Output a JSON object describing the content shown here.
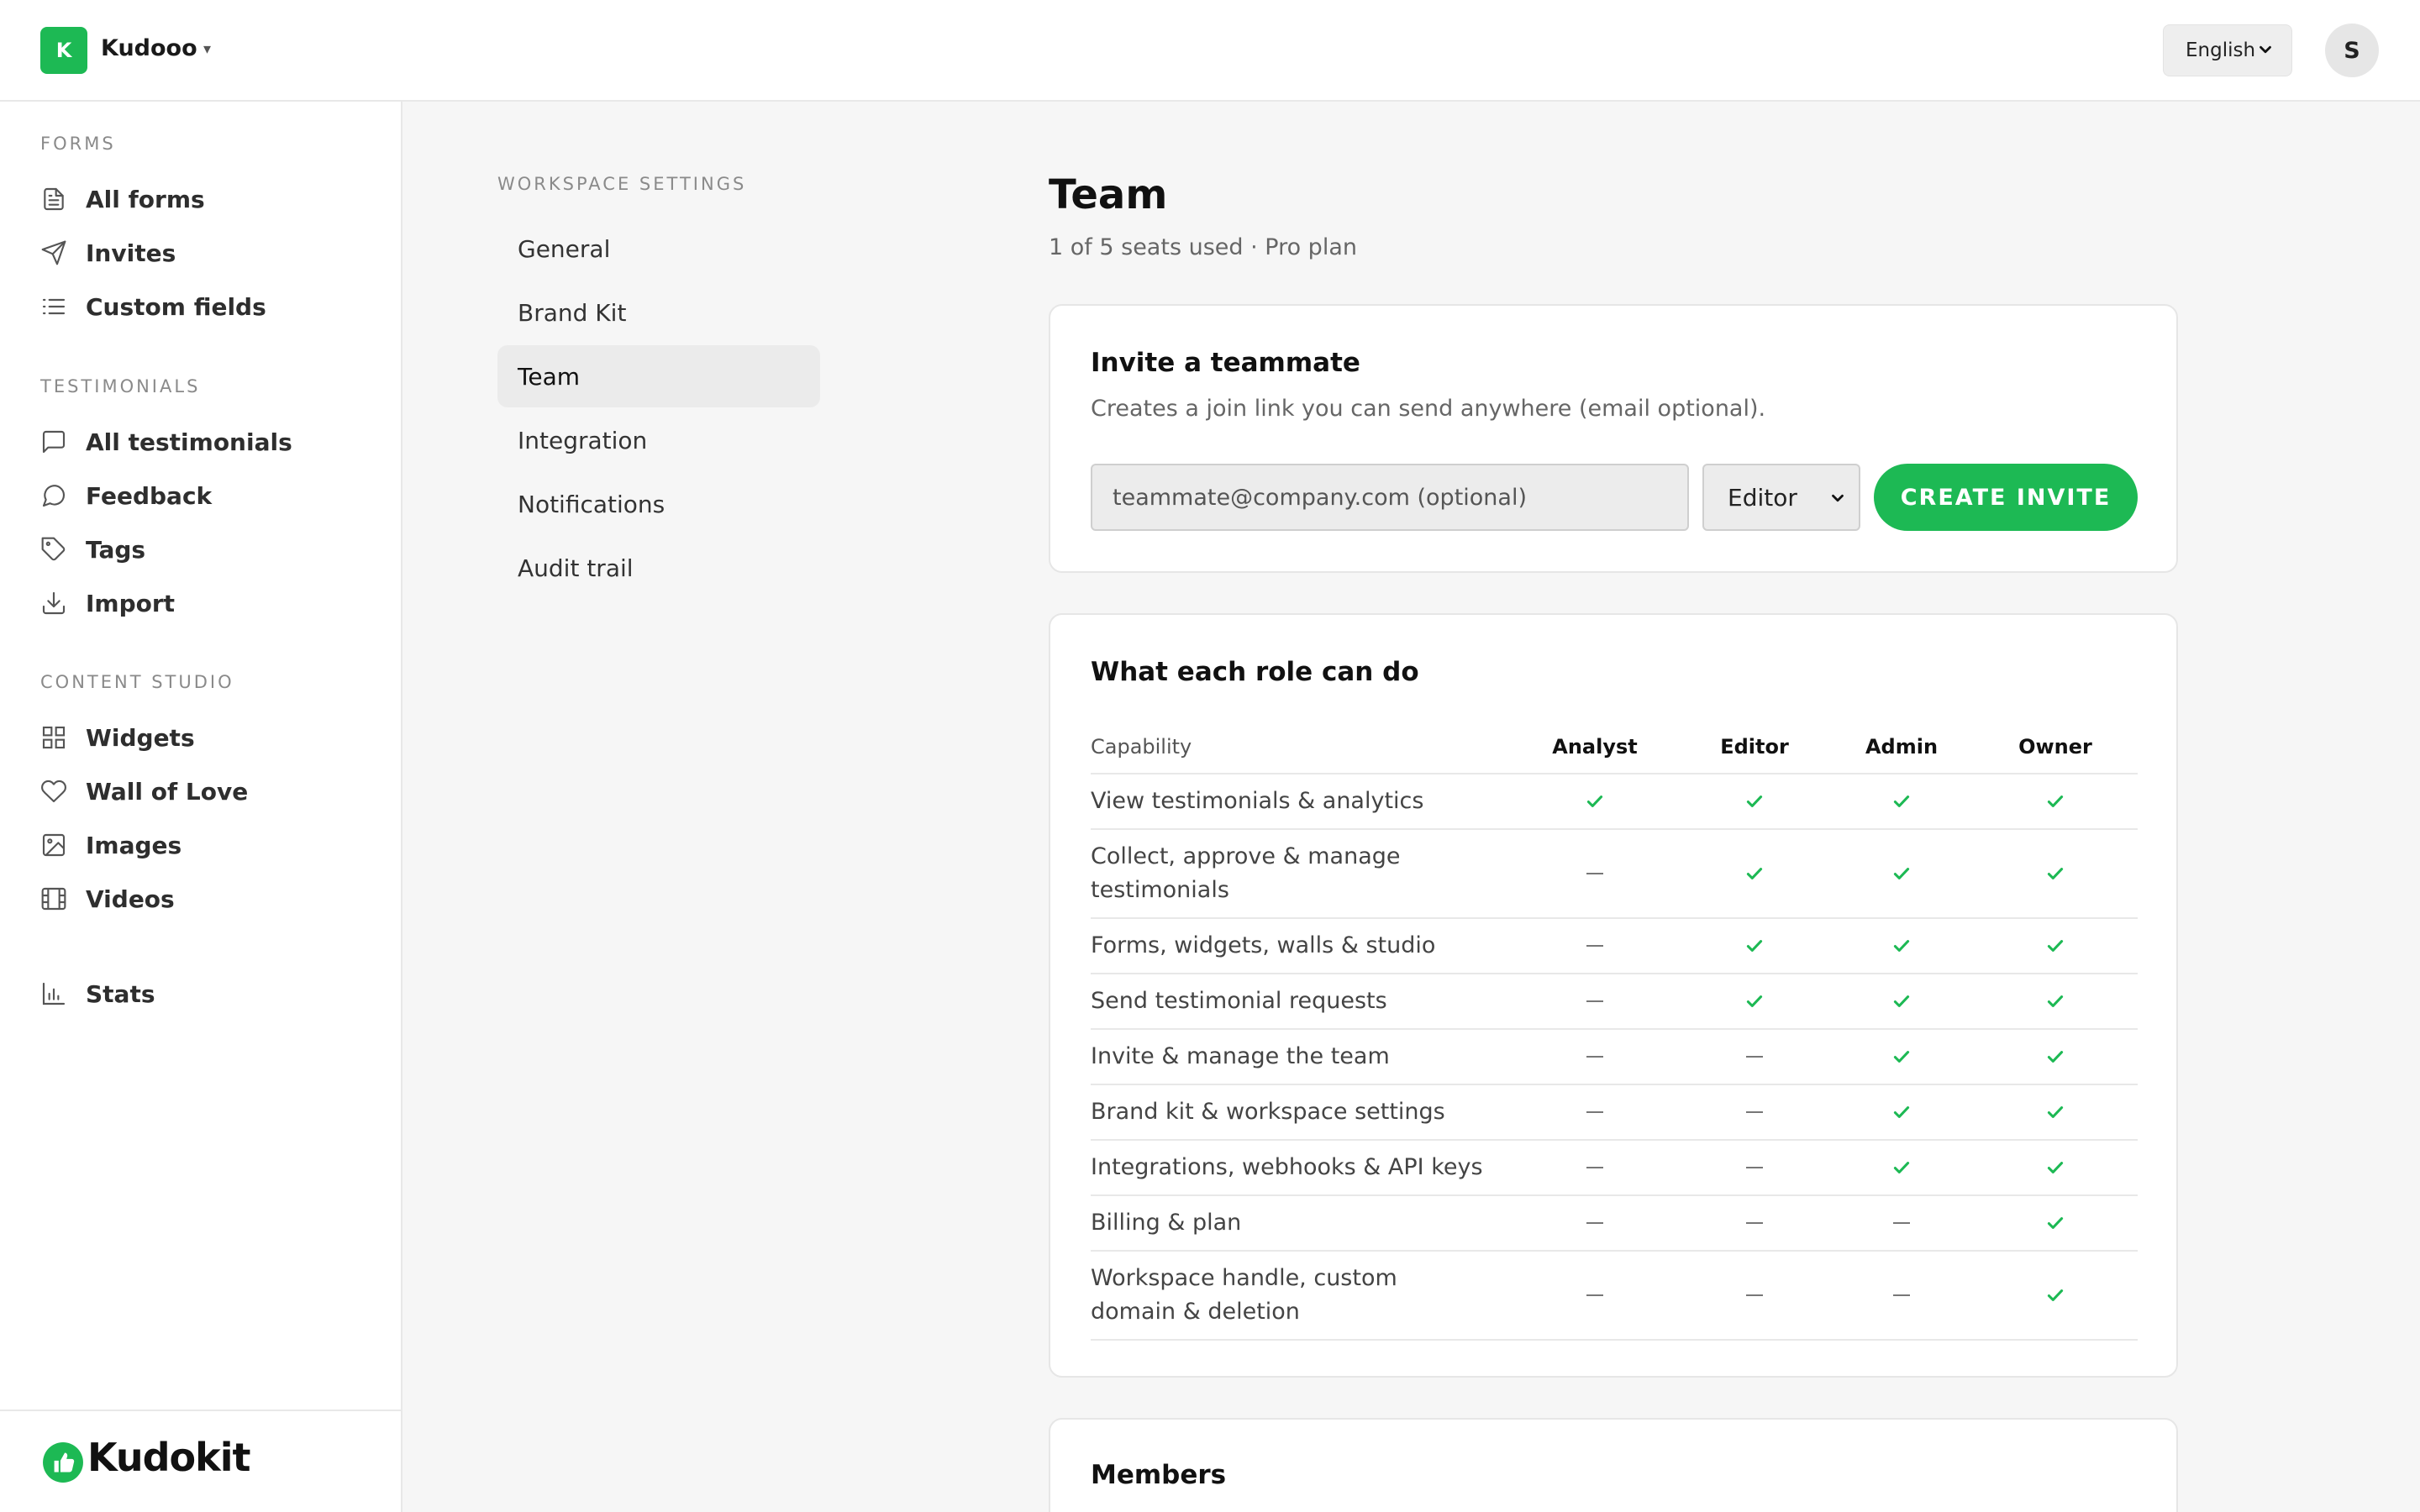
{
  "topbar": {
    "workspace_initial": "K",
    "workspace_name": "Kudooo",
    "workspace_caret": "▾",
    "language": "English",
    "user_initial": "S"
  },
  "sidebar": {
    "sections": [
      {
        "heading": "FORMS",
        "items": [
          {
            "label": "All forms",
            "icon": "document-icon"
          },
          {
            "label": "Invites",
            "icon": "send-icon"
          },
          {
            "label": "Custom fields",
            "icon": "list-icon"
          }
        ]
      },
      {
        "heading": "TESTIMONIALS",
        "items": [
          {
            "label": "All testimonials",
            "icon": "message-square-icon"
          },
          {
            "label": "Feedback",
            "icon": "message-circle-icon"
          },
          {
            "label": "Tags",
            "icon": "tag-icon"
          },
          {
            "label": "Import",
            "icon": "download-icon"
          }
        ]
      },
      {
        "heading": "CONTENT STUDIO",
        "items": [
          {
            "label": "Widgets",
            "icon": "grid-icon"
          },
          {
            "label": "Wall of Love",
            "icon": "heart-icon"
          },
          {
            "label": "Images",
            "icon": "image-icon"
          },
          {
            "label": "Videos",
            "icon": "film-icon"
          }
        ]
      }
    ],
    "stats_label": "Stats",
    "brand_name": "Kudokit"
  },
  "settings_nav": {
    "heading": "WORKSPACE SETTINGS",
    "items": [
      "General",
      "Brand Kit",
      "Team",
      "Integration",
      "Notifications",
      "Audit trail"
    ],
    "active": "Team"
  },
  "main": {
    "title": "Team",
    "subtitle": "1 of 5 seats used · Pro plan",
    "invite": {
      "title": "Invite a teammate",
      "description": "Creates a join link you can send anywhere (email optional).",
      "email_placeholder": "teammate@company.com (optional)",
      "role_value": "Editor",
      "button_label": "CREATE INVITE"
    },
    "roles": {
      "title": "What each role can do",
      "columns": [
        "Capability",
        "Analyst",
        "Editor",
        "Admin",
        "Owner"
      ],
      "rows": [
        {
          "capability": "View testimonials & analytics",
          "access": [
            true,
            true,
            true,
            true
          ]
        },
        {
          "capability": "Collect, approve & manage testimonials",
          "access": [
            false,
            true,
            true,
            true
          ]
        },
        {
          "capability": "Forms, widgets, walls & studio",
          "access": [
            false,
            true,
            true,
            true
          ]
        },
        {
          "capability": "Send testimonial requests",
          "access": [
            false,
            true,
            true,
            true
          ]
        },
        {
          "capability": "Invite & manage the team",
          "access": [
            false,
            false,
            true,
            true
          ]
        },
        {
          "capability": "Brand kit & workspace settings",
          "access": [
            false,
            false,
            true,
            true
          ]
        },
        {
          "capability": "Integrations, webhooks & API keys",
          "access": [
            false,
            false,
            true,
            true
          ]
        },
        {
          "capability": "Billing & plan",
          "access": [
            false,
            false,
            false,
            true
          ]
        },
        {
          "capability": "Workspace handle, custom domain & deletion",
          "access": [
            false,
            false,
            false,
            true
          ]
        }
      ]
    },
    "members_title": "Members"
  },
  "colors": {
    "accent": "#1db954",
    "background": "#f6f6f6",
    "card": "#ffffff",
    "border": "#e6e6e6"
  }
}
